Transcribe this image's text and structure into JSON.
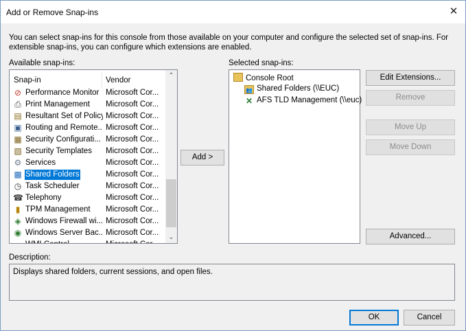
{
  "window": {
    "title": "Add or Remove Snap-ins"
  },
  "intro": "You can select snap-ins for this console from those available on your computer and configure the selected set of snap-ins. For extensible snap-ins, you can configure which extensions are enabled.",
  "available": {
    "label": "Available snap-ins:",
    "columns": {
      "name": "Snap-in",
      "vendor": "Vendor"
    },
    "rows": [
      {
        "name": "Performance Monitor",
        "vendor": "Microsoft Cor...",
        "icon": "performance-monitor-icon"
      },
      {
        "name": "Print Management",
        "vendor": "Microsoft Cor...",
        "icon": "printer-icon"
      },
      {
        "name": "Resultant Set of Policy",
        "vendor": "Microsoft Cor...",
        "icon": "policy-document-icon"
      },
      {
        "name": "Routing and Remote...",
        "vendor": "Microsoft Cor...",
        "icon": "routing-icon"
      },
      {
        "name": "Security Configurati...",
        "vendor": "Microsoft Cor...",
        "icon": "security-config-icon"
      },
      {
        "name": "Security Templates",
        "vendor": "Microsoft Cor...",
        "icon": "security-template-icon"
      },
      {
        "name": "Services",
        "vendor": "Microsoft Cor...",
        "icon": "services-gear-icon"
      },
      {
        "name": "Shared Folders",
        "vendor": "Microsoft Cor...",
        "icon": "shared-folders-icon"
      },
      {
        "name": "Task Scheduler",
        "vendor": "Microsoft Cor...",
        "icon": "clock-icon"
      },
      {
        "name": "Telephony",
        "vendor": "Microsoft Cor...",
        "icon": "telephony-icon"
      },
      {
        "name": "TPM Management",
        "vendor": "Microsoft Cor...",
        "icon": "tpm-chip-icon"
      },
      {
        "name": "Windows Firewall wi...",
        "vendor": "Microsoft Cor...",
        "icon": "firewall-icon"
      },
      {
        "name": "Windows Server Bac...",
        "vendor": "Microsoft Cor...",
        "icon": "server-backup-icon"
      },
      {
        "name": "WMI Control",
        "vendor": "Microsoft Cor...",
        "icon": "wmi-icon"
      }
    ],
    "selected_index": 7
  },
  "add_button": "Add >",
  "selected": {
    "label": "Selected snap-ins:",
    "root": {
      "label": "Console Root",
      "icon": "console-root-folder-icon"
    },
    "children": [
      {
        "label": "Shared Folders (\\\\EUC)",
        "icon": "shared-folders-icon"
      },
      {
        "label": "AFS TLD Management (\\\\euc)",
        "icon": "afs-tld-icon"
      }
    ]
  },
  "buttons": {
    "edit_extensions": "Edit Extensions...",
    "remove": "Remove",
    "move_up": "Move Up",
    "move_down": "Move Down",
    "advanced": "Advanced...",
    "ok": "OK",
    "cancel": "Cancel"
  },
  "description": {
    "label": "Description:",
    "text": "Displays shared folders, current sessions, and open files."
  },
  "colors": {
    "selection": "#0078d7",
    "dialog_bg": "#f0f0f0"
  }
}
